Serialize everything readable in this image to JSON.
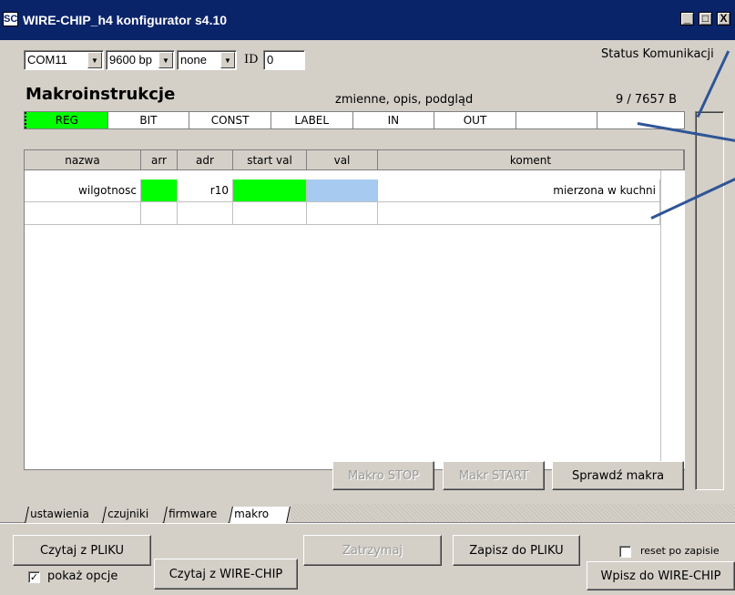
{
  "window": {
    "icon_text": "SC",
    "title": "WIRE-CHIP_h4 konfigurator s4.10",
    "minimize": "_",
    "maximize": "□",
    "close": "X"
  },
  "connection": {
    "port": "COM11",
    "baud": "9600 bp",
    "parity": "none",
    "id_label": "ID",
    "id_value": "0",
    "status_label": "Status Komunikacji"
  },
  "section": {
    "title": "Makroinstrukcje",
    "subtitle": "zmienne, opis, podgląd",
    "usage": "9 / 7657 B"
  },
  "categories": [
    "REG",
    "BIT",
    "CONST",
    "LABEL",
    "IN",
    "OUT",
    "",
    ""
  ],
  "table": {
    "headers": [
      "nazwa",
      "arr",
      "adr",
      "start val",
      "val",
      "koment"
    ],
    "rows": [
      [
        "wilgotnosc",
        "",
        "r10",
        "",
        "",
        "mierzona w kuchni"
      ],
      [
        "",
        "",
        "",
        "",
        "",
        ""
      ]
    ]
  },
  "macro_buttons": {
    "stop": "Makro STOP",
    "start": "Makr START",
    "check": "Sprawdź makra"
  },
  "tabs": [
    "ustawienia",
    "czujniki",
    "firmware",
    "makro"
  ],
  "bottom": {
    "read_file": "Czytaj z PLIKU",
    "show_options": "pokaż opcje",
    "read_chip": "Czytaj z WIRE-CHIP",
    "pause": "Zatrzymaj",
    "save_file": "Zapisz do PLIKU",
    "reset_after": "reset po zapisie",
    "write_chip": "Wpisz do WIRE-CHIP"
  },
  "colors": {
    "titlebar": "#0a246a",
    "active_category": "#00ff00",
    "green_cell": "#00ff00",
    "blue_cell": "#a6caf0",
    "arrow": "#2f5597"
  }
}
